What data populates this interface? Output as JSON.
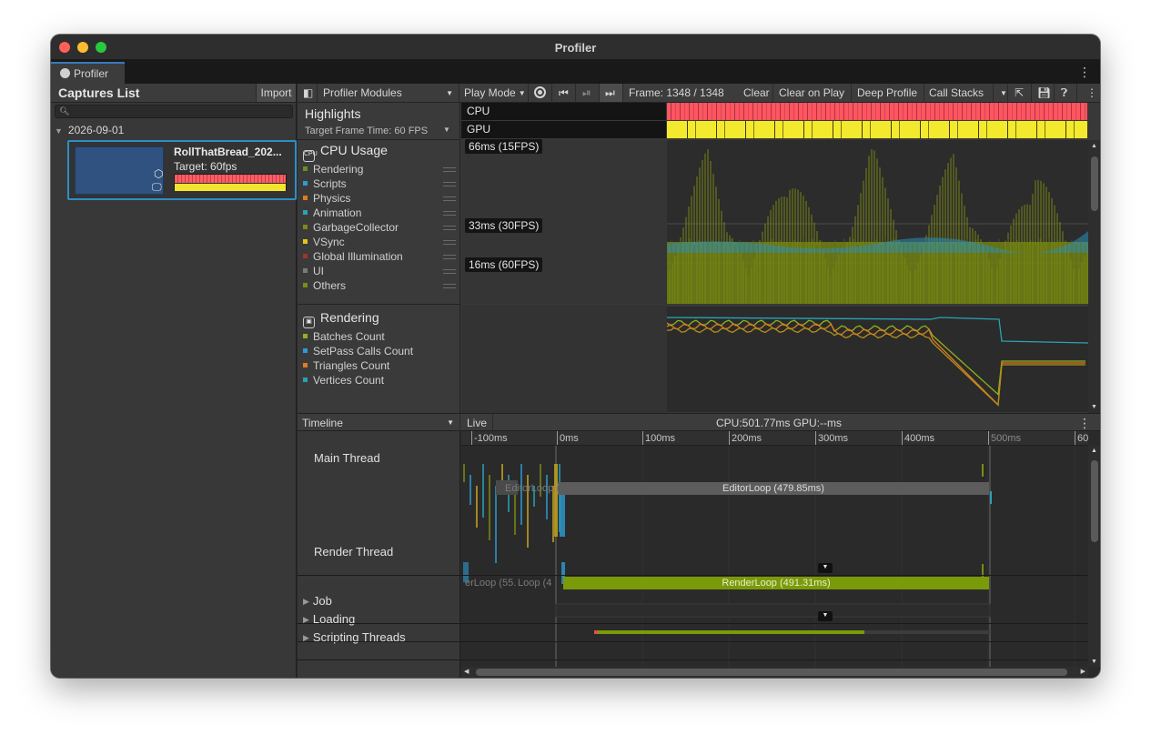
{
  "window": {
    "title": "Profiler"
  },
  "tab": {
    "label": "Profiler",
    "menu": "⋮"
  },
  "captures": {
    "title": "Captures List",
    "import_label": "Import",
    "search_placeholder": "",
    "date": "2026-09-01",
    "item": {
      "name": "RollThatBread_202...",
      "target": "Target: 60fps"
    }
  },
  "toolbar": {
    "modules": "Profiler Modules",
    "play_mode": "Play Mode",
    "frame": "Frame: 1348 / 1348",
    "clear": "Clear",
    "clear_on_play": "Clear on Play",
    "deep_profile": "Deep Profile",
    "call_stacks": "Call Stacks"
  },
  "highlights": {
    "title": "Highlights",
    "target": "Target Frame Time: 60 FPS",
    "lanes": [
      "CPU",
      "GPU"
    ]
  },
  "cpu_module": {
    "title": "CPU Usage",
    "legend": [
      {
        "label": "Rendering",
        "color": "#6b8e23"
      },
      {
        "label": "Scripts",
        "color": "#2d9bd2"
      },
      {
        "label": "Physics",
        "color": "#e07b1e"
      },
      {
        "label": "Animation",
        "color": "#2aa3b5"
      },
      {
        "label": "GarbageCollector",
        "color": "#7b8a1a"
      },
      {
        "label": "VSync",
        "color": "#e8c416"
      },
      {
        "label": "Global Illumination",
        "color": "#a0352a"
      },
      {
        "label": "UI",
        "color": "#7a7a7a"
      },
      {
        "label": "Others",
        "color": "#7c8c14"
      }
    ],
    "fps_labels": [
      "66ms (15FPS)",
      "33ms (30FPS)",
      "16ms (60FPS)"
    ]
  },
  "rendering_module": {
    "title": "Rendering",
    "legend": [
      {
        "label": "Batches Count",
        "color": "#8fb31c"
      },
      {
        "label": "SetPass Calls Count",
        "color": "#2d9bd2"
      },
      {
        "label": "Triangles Count",
        "color": "#e07b1e"
      },
      {
        "label": "Vertices Count",
        "color": "#2aa3b5"
      }
    ]
  },
  "timeline": {
    "view": "Timeline",
    "live": "Live",
    "stats": "CPU:501.77ms   GPU:--ms",
    "ticks": [
      "-100ms",
      "0ms",
      "100ms",
      "200ms",
      "300ms",
      "400ms",
      "500ms",
      "60"
    ],
    "threads": [
      "Main Thread",
      "Render Thread"
    ],
    "groups": [
      "Job",
      "Loading",
      "Scripting Threads"
    ],
    "editor_loop": "EditorLoop (479.85ms)",
    "render_loop": "RenderLoop (491.31ms)",
    "ghost_editor": "EditorLoop (",
    "ghost_render_a": "erLoop (55.",
    "ghost_render_b": "Loop (4"
  }
}
